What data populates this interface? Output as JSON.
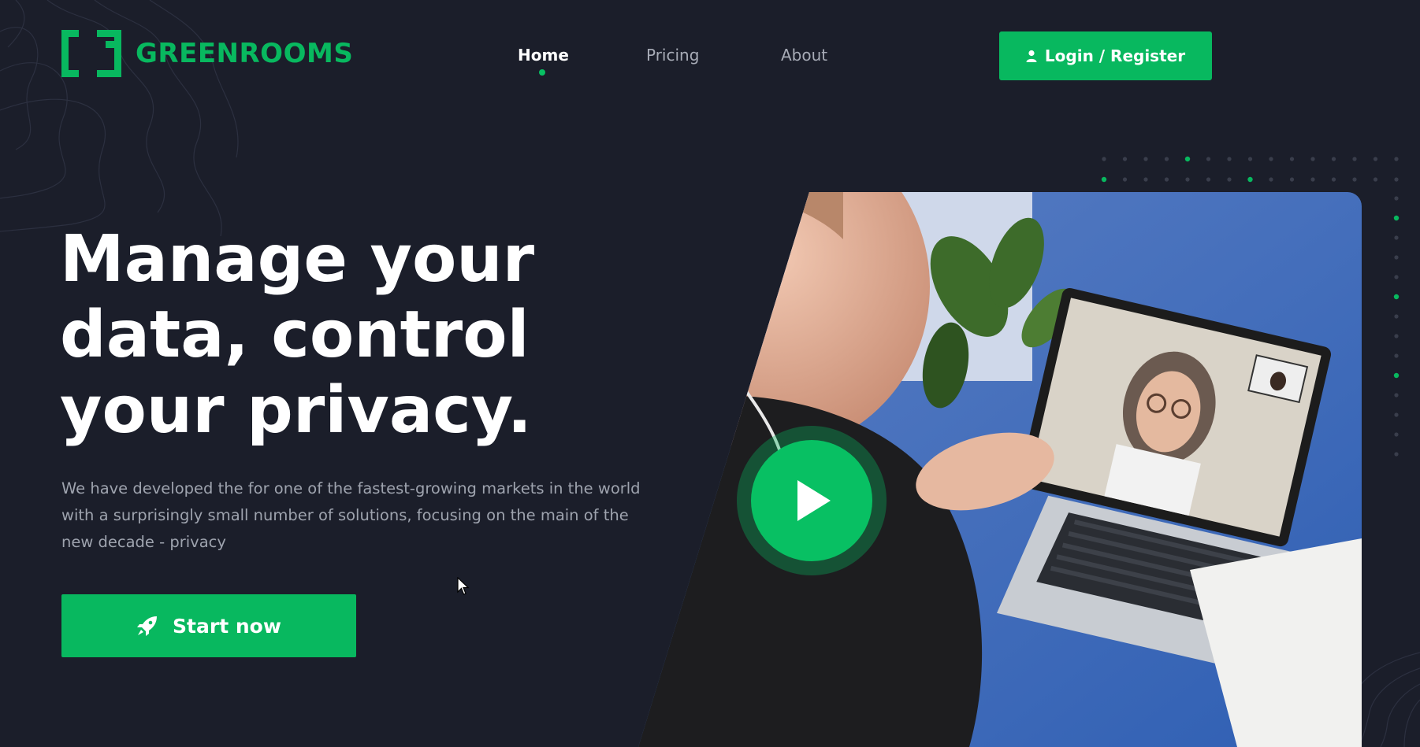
{
  "brand": {
    "name": "GREENROOMS",
    "accent_color": "#08b85f"
  },
  "nav": {
    "items": [
      {
        "label": "Home",
        "active": true
      },
      {
        "label": "Pricing",
        "active": false
      },
      {
        "label": "About",
        "active": false
      }
    ]
  },
  "header": {
    "login_label": "Login / Register",
    "login_icon": "user-icon"
  },
  "hero": {
    "headline_lines": [
      "Manage your",
      "data, control",
      "your privacy."
    ],
    "subtext": "We have developed the for one of the fastest-growing markets in the world with a surprisingly small number of solutions, focusing on the main of the new decade - privacy",
    "cta_label": "Start now",
    "cta_icon": "rocket-icon"
  },
  "media": {
    "play_icon": "play-icon"
  },
  "colors": {
    "background": "#1b1e2a",
    "muted_text": "#9ea3ae",
    "nav_inactive": "#a7abb6"
  }
}
